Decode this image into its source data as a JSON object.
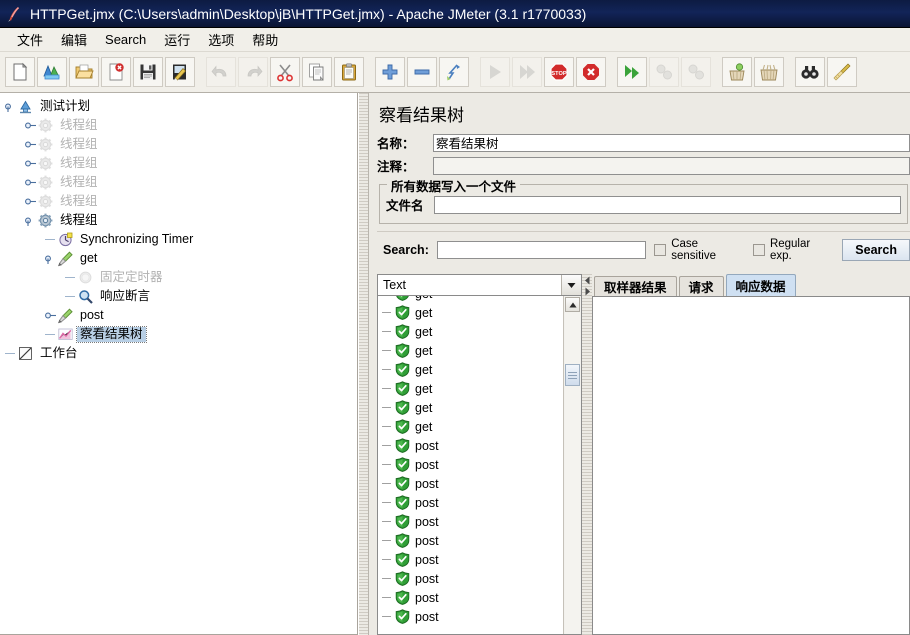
{
  "window": {
    "title": "HTTPGet.jmx (C:\\Users\\admin\\Desktop\\jB\\HTTPGet.jmx) - Apache JMeter (3.1 r1770033)",
    "app_icon": "jmeter-feather-icon"
  },
  "menubar": {
    "items": [
      {
        "label": "文件",
        "name": "menu-file"
      },
      {
        "label": "编辑",
        "name": "menu-edit"
      },
      {
        "label": "Search",
        "name": "menu-search"
      },
      {
        "label": "运行",
        "name": "menu-run"
      },
      {
        "label": "选项",
        "name": "menu-options"
      },
      {
        "label": "帮助",
        "name": "menu-help"
      }
    ]
  },
  "toolbar": {
    "buttons": [
      {
        "name": "new-button",
        "icon": "new-page-icon",
        "enabled": true
      },
      {
        "name": "templates-button",
        "icon": "templates-icon",
        "enabled": true
      },
      {
        "name": "open-button",
        "icon": "open-folder-icon",
        "enabled": true
      },
      {
        "name": "close-button",
        "icon": "close-page-icon",
        "enabled": true
      },
      {
        "name": "save-button",
        "icon": "floppy-disk-icon",
        "enabled": true
      },
      {
        "name": "save-as-button",
        "icon": "save-as-icon",
        "enabled": true
      },
      {
        "name": "undo-button",
        "icon": "undo-arrow-icon",
        "enabled": false
      },
      {
        "name": "redo-button",
        "icon": "redo-arrow-icon",
        "enabled": false
      },
      {
        "name": "cut-button",
        "icon": "scissors-icon",
        "enabled": true
      },
      {
        "name": "copy-button",
        "icon": "copy-icon",
        "enabled": true
      },
      {
        "name": "paste-button",
        "icon": "clipboard-icon",
        "enabled": true
      },
      {
        "name": "expand-all-button",
        "icon": "plus-icon",
        "enabled": true
      },
      {
        "name": "collapse-all-button",
        "icon": "minus-icon",
        "enabled": true
      },
      {
        "name": "toggle-button",
        "icon": "toggle-icon",
        "enabled": true
      },
      {
        "name": "start-button",
        "icon": "play-icon",
        "enabled": false
      },
      {
        "name": "start-no-pauses-button",
        "icon": "play-no-pause-icon",
        "enabled": false
      },
      {
        "name": "stop-button",
        "icon": "stop-sign-icon",
        "enabled": true
      },
      {
        "name": "shutdown-button",
        "icon": "shutdown-icon",
        "enabled": true
      },
      {
        "name": "start-remote-button",
        "icon": "remote-start-icon",
        "enabled": true
      },
      {
        "name": "stop-remote-button",
        "icon": "remote-stop-icon",
        "enabled": false
      },
      {
        "name": "shutdown-remote-button",
        "icon": "remote-shutdown-icon",
        "enabled": false
      },
      {
        "name": "clear-button",
        "icon": "clear-icon",
        "enabled": true
      },
      {
        "name": "clear-all-button",
        "icon": "clear-all-icon",
        "enabled": true
      },
      {
        "name": "search-button",
        "icon": "binoculars-icon",
        "enabled": true
      },
      {
        "name": "reset-search-button",
        "icon": "broom-icon",
        "enabled": true
      }
    ]
  },
  "tree": {
    "nodes": [
      {
        "label": "测试计划",
        "icon": "test-plan-icon",
        "depth": 0,
        "dim": false,
        "selected": false,
        "expanded": true
      },
      {
        "label": "线程组",
        "icon": "thread-group-icon",
        "depth": 1,
        "dim": true,
        "selected": false,
        "expanded": false
      },
      {
        "label": "线程组",
        "icon": "thread-group-icon",
        "depth": 1,
        "dim": true,
        "selected": false,
        "expanded": false
      },
      {
        "label": "线程组",
        "icon": "thread-group-icon",
        "depth": 1,
        "dim": true,
        "selected": false,
        "expanded": false
      },
      {
        "label": "线程组",
        "icon": "thread-group-icon",
        "depth": 1,
        "dim": true,
        "selected": false,
        "expanded": false
      },
      {
        "label": "线程组",
        "icon": "thread-group-icon",
        "depth": 1,
        "dim": true,
        "selected": false,
        "expanded": false
      },
      {
        "label": "线程组",
        "icon": "thread-group-icon",
        "depth": 1,
        "dim": false,
        "selected": false,
        "expanded": true
      },
      {
        "label": "Synchronizing Timer",
        "icon": "sync-timer-icon",
        "depth": 2,
        "dim": false,
        "selected": false,
        "expanded": false
      },
      {
        "label": "get",
        "icon": "http-sampler-icon",
        "depth": 2,
        "dim": false,
        "selected": false,
        "expanded": true
      },
      {
        "label": "固定定时器",
        "icon": "constant-timer-icon",
        "depth": 3,
        "dim": true,
        "selected": false,
        "expanded": false
      },
      {
        "label": "响应断言",
        "icon": "response-assertion-icon",
        "depth": 3,
        "dim": false,
        "selected": false,
        "expanded": false
      },
      {
        "label": "post",
        "icon": "http-sampler-icon",
        "depth": 2,
        "dim": false,
        "selected": false,
        "expanded": false
      },
      {
        "label": "察看结果树",
        "icon": "view-results-tree-icon",
        "depth": 2,
        "dim": false,
        "selected": true,
        "expanded": false
      },
      {
        "label": "工作台",
        "icon": "workbench-icon",
        "depth": 0,
        "dim": false,
        "selected": false,
        "expanded": false
      }
    ]
  },
  "panel": {
    "title": "察看结果树",
    "name_label": "名称：",
    "name_value": "察看结果树",
    "comment_label": "注释：",
    "comment_value": "",
    "file_group_title": "所有数据写入一个文件",
    "filename_label": "文件名",
    "filename_value": ""
  },
  "search": {
    "label": "Search:",
    "value": "",
    "case_sensitive_label": "Case sensitive",
    "case_sensitive_checked": false,
    "regular_exp_label": "Regular exp.",
    "regular_exp_checked": false,
    "button_label": "Search"
  },
  "results": {
    "renderer_selected": "Text",
    "rows": [
      {
        "label": "get",
        "status": "success"
      },
      {
        "label": "get",
        "status": "success"
      },
      {
        "label": "get",
        "status": "success"
      },
      {
        "label": "get",
        "status": "success"
      },
      {
        "label": "get",
        "status": "success"
      },
      {
        "label": "get",
        "status": "success"
      },
      {
        "label": "get",
        "status": "success"
      },
      {
        "label": "get",
        "status": "success"
      },
      {
        "label": "post",
        "status": "success"
      },
      {
        "label": "post",
        "status": "success"
      },
      {
        "label": "post",
        "status": "success"
      },
      {
        "label": "post",
        "status": "success"
      },
      {
        "label": "post",
        "status": "success"
      },
      {
        "label": "post",
        "status": "success"
      },
      {
        "label": "post",
        "status": "success"
      },
      {
        "label": "post",
        "status": "success"
      },
      {
        "label": "post",
        "status": "success"
      },
      {
        "label": "post",
        "status": "success"
      }
    ]
  },
  "detail_tabs": [
    {
      "label": "取样器结果",
      "name": "tab-sampler-result",
      "active": false
    },
    {
      "label": "请求",
      "name": "tab-request",
      "active": false
    },
    {
      "label": "响应数据",
      "name": "tab-response-data",
      "active": true
    }
  ],
  "colors": {
    "titlebar": "#0d1b42",
    "toolbar_bg": "#f1efe9",
    "panel_bg": "#eceae4",
    "selection": "#b8cfe5",
    "active_tab": "#cfe0f2",
    "success_green": "#2f9e36"
  }
}
